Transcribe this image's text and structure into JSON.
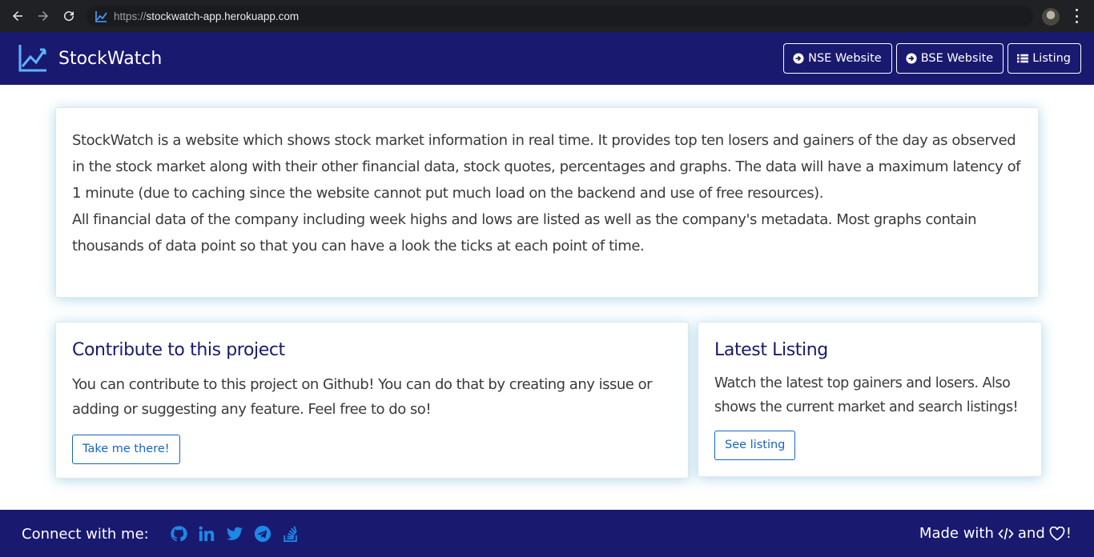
{
  "browser": {
    "url_scheme": "https://",
    "url_host": "stockwatch-app.herokuapp.com"
  },
  "navbar": {
    "brand": "StockWatch",
    "buttons": [
      {
        "label": "NSE Website",
        "icon": "arrow-circle-right-icon"
      },
      {
        "label": "BSE Website",
        "icon": "arrow-circle-right-icon"
      },
      {
        "label": "Listing",
        "icon": "list-icon"
      }
    ]
  },
  "about": {
    "paragraph1": "StockWatch is a website which shows stock market information in real time. It provides top ten losers and gainers of the day as observed in the stock market along with their other financial data, stock quotes, percentages and graphs. The data will have a maximum latency of 1 minute (due to caching since the website cannot put much load on the backend and use of free resources).",
    "paragraph2": "All financial data of the company including week highs and lows are listed as well as the company's metadata. Most graphs contain thousands of data point so that you can have a look the ticks at each point of time."
  },
  "contribute": {
    "title": "Contribute to this project",
    "text": "You can contribute to this project on Github! You can do that by creating any issue or adding or suggesting any feature. Feel free to do so!",
    "button": "Take me there!"
  },
  "latest": {
    "title": "Latest Listing",
    "text": "Watch the latest top gainers and losers. Also shows the current market and search listings!",
    "button": "See listing"
  },
  "footer": {
    "connect_label": "Connect with me:",
    "social_icons": [
      "github-icon",
      "linkedin-icon",
      "twitter-icon",
      "telegram-icon",
      "stackoverflow-icon"
    ],
    "made_with_prefix": "Made with",
    "made_with_and": "and",
    "made_with_suffix": "!"
  },
  "colors": {
    "navbar_bg": "#191970",
    "accent": "#1565c0",
    "social_blue": "#1e88e5"
  }
}
